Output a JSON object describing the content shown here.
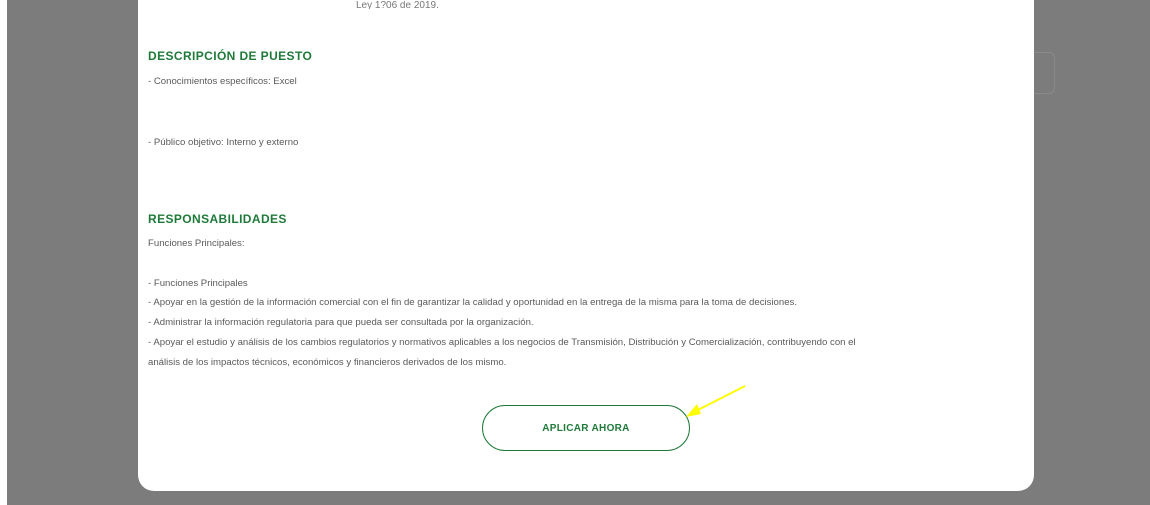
{
  "top_cut_text": "Ley 1?06 de 2019.",
  "description": {
    "heading": "DESCRIPCIÓN DE PUESTO",
    "knowledge": "- Conocimientos específicos:  Excel",
    "audience": "-  Público objetivo: Interno y externo"
  },
  "responsibilities": {
    "heading": "RESPONSABILIDADES",
    "subheading": "Funciones Principales:",
    "items": [
      "- Funciones Principales",
      "- Apoyar en la gestión de la información comercial con el fin de garantizar la calidad y oportunidad en la entrega de la misma para la toma de decisiones.",
      "- Administrar la información regulatoria para que pueda ser consultada por la organización.",
      "- Apoyar el estudio y análisis de los cambios regulatorios y normativos aplicables a los negocios de Transmisión, Distribución y Comercialización, contribuyendo con el",
      "análisis de los impactos técnicos, económicos y financieros derivados de los mismo."
    ]
  },
  "apply_button": "APLICAR AHORA",
  "colors": {
    "accent_green": "#1f7a3a",
    "overlay_gray": "#7c7c7c",
    "annotation_yellow": "#ffff00"
  },
  "icons": {
    "annotation": "yellow-arrow-icon"
  }
}
